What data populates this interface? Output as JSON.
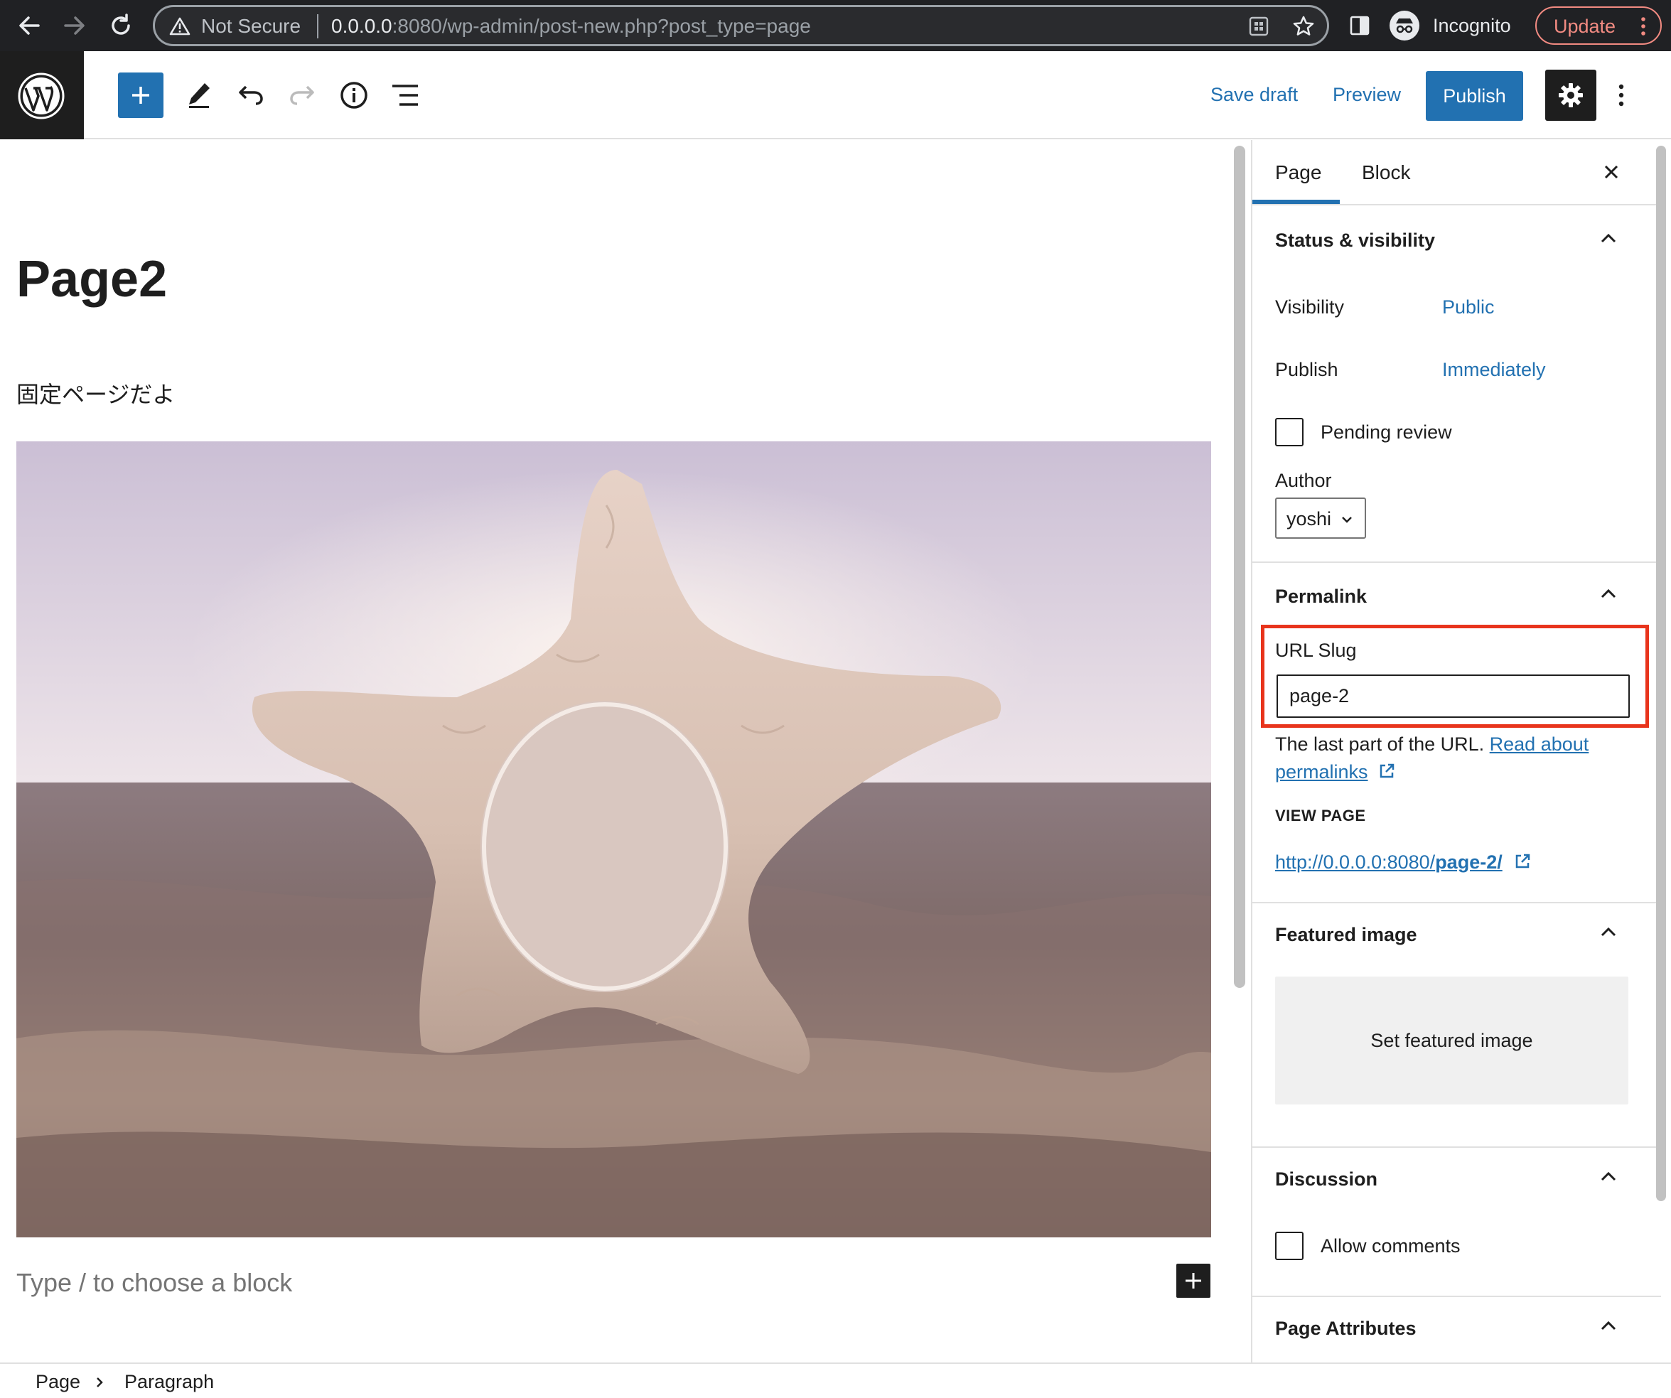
{
  "browser": {
    "security_label": "Not Secure",
    "url_host": "0.0.0.0",
    "url_rest": ":8080/wp-admin/post-new.php?post_type=page",
    "profile_label": "Incognito",
    "update_label": "Update"
  },
  "header": {
    "save_draft": "Save draft",
    "preview": "Preview",
    "publish": "Publish"
  },
  "editor": {
    "title": "Page2",
    "paragraph": "固定ページだよ",
    "placeholder": "Type / to choose a block"
  },
  "sidebar": {
    "tabs": [
      "Page",
      "Block"
    ],
    "status": {
      "title": "Status & visibility",
      "visibility_label": "Visibility",
      "visibility_value": "Public",
      "publish_label": "Publish",
      "publish_value": "Immediately",
      "pending_label": "Pending review",
      "author_label": "Author",
      "author_value": "yoshi"
    },
    "permalink": {
      "title": "Permalink",
      "slug_label": "URL Slug",
      "slug_value": "page-2",
      "help_text": "The last part of the URL.",
      "help_link_1": "Read about",
      "help_link_2": "permalinks",
      "view_label": "VIEW PAGE",
      "view_url_prefix": "http://0.0.0.0:8080/",
      "view_url_slug": "page-2/"
    },
    "featured": {
      "title": "Featured image",
      "button": "Set featured image"
    },
    "discussion": {
      "title": "Discussion",
      "allow_label": "Allow comments"
    },
    "attributes": {
      "title": "Page Attributes"
    }
  },
  "footer": {
    "crumbs": [
      "Page",
      "Paragraph"
    ]
  },
  "colors": {
    "accent": "#2271b1",
    "highlight": "#e8341c",
    "dark": "#1e1e1e"
  }
}
